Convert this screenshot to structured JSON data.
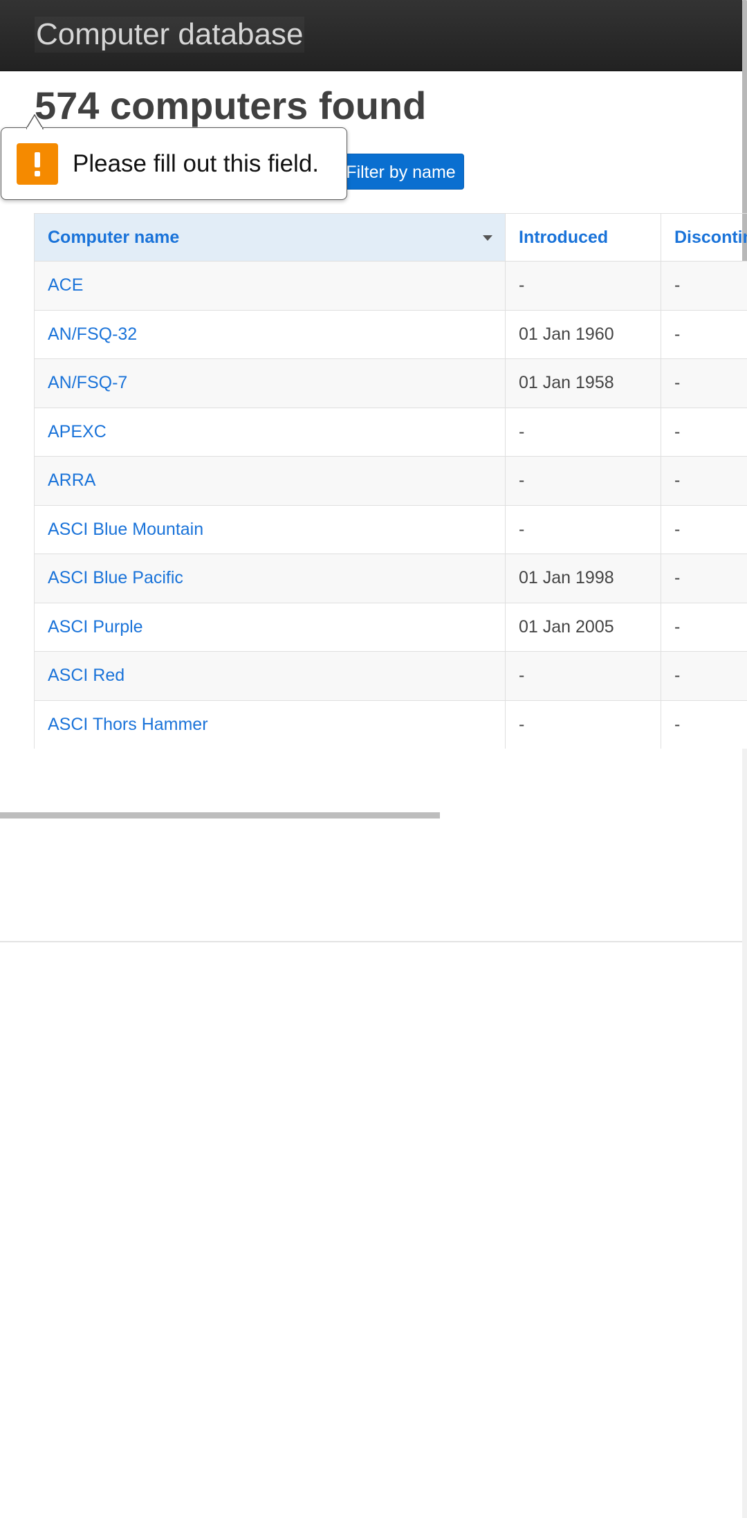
{
  "header": {
    "brand": "Computer database"
  },
  "main": {
    "heading": "574 computers found",
    "filter_button_label": "Filter by name"
  },
  "validation_tooltip": {
    "message": "Please fill out this field.",
    "icon": "warning-icon",
    "icon_color": "#f58a00"
  },
  "table": {
    "columns": [
      "Computer name",
      "Introduced",
      "Discontinued"
    ],
    "sorted_column": "Computer name",
    "rows": [
      {
        "name": "ACE",
        "introduced": "-",
        "discontinued": "-"
      },
      {
        "name": "AN/FSQ-32",
        "introduced": "01 Jan 1960",
        "discontinued": "-"
      },
      {
        "name": "AN/FSQ-7",
        "introduced": "01 Jan 1958",
        "discontinued": "-"
      },
      {
        "name": "APEXC",
        "introduced": "-",
        "discontinued": "-"
      },
      {
        "name": "ARRA",
        "introduced": "-",
        "discontinued": "-"
      },
      {
        "name": "ASCI Blue Mountain",
        "introduced": "-",
        "discontinued": "-"
      },
      {
        "name": "ASCI Blue Pacific",
        "introduced": "01 Jan 1998",
        "discontinued": "-"
      },
      {
        "name": "ASCI Purple",
        "introduced": "01 Jan 2005",
        "discontinued": "-"
      },
      {
        "name": "ASCI Red",
        "introduced": "-",
        "discontinued": "-"
      },
      {
        "name": "ASCI Thors Hammer",
        "introduced": "-",
        "discontinued": "-"
      }
    ]
  },
  "colors": {
    "topbar": "#2b2b2b",
    "primary_button": "#0a6fd0",
    "link": "#1a73d9",
    "sorted_header_bg": "#e2edf7"
  }
}
